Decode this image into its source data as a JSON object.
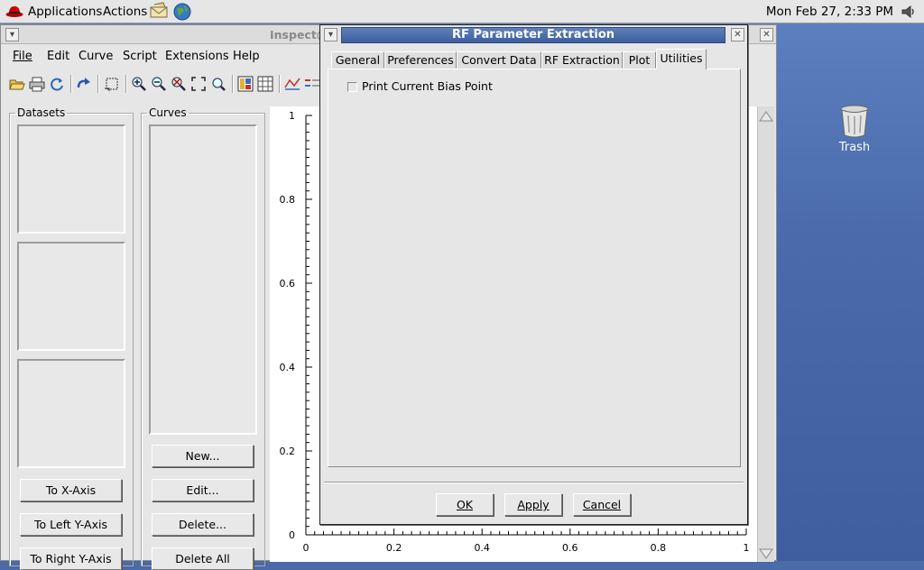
{
  "panel": {
    "applications": "Applications",
    "actions": "Actions",
    "clock": "Mon Feb 27,  2:33 PM"
  },
  "desktop": {
    "trash_label": "Trash"
  },
  "main_window": {
    "title": "Inspect@",
    "menu": [
      {
        "label": "File"
      },
      {
        "label": "Edit"
      },
      {
        "label": "Curve"
      },
      {
        "label": "Script"
      },
      {
        "label": "Extensions"
      },
      {
        "label": "Help"
      }
    ],
    "datasets_label": "Datasets",
    "curves_label": "Curves",
    "buttons": {
      "to_x_axis": "To X-Axis",
      "to_left_y_axis": "To Left Y-Axis",
      "to_right_y_axis": "To Right Y-Axis",
      "new": "New...",
      "edit": "Edit...",
      "delete": "Delete...",
      "delete_all": "Delete All"
    }
  },
  "dialog": {
    "title": "RF Parameter Extraction",
    "tabs": [
      {
        "label": "General"
      },
      {
        "label": "Preferences"
      },
      {
        "label": "Convert Data"
      },
      {
        "label": "RF Extraction"
      },
      {
        "label": "Plot"
      },
      {
        "label": "Utilities"
      }
    ],
    "active_tab": "Utilities",
    "checkbox_label": "Print Current Bias Point",
    "checkbox_checked": false,
    "ok": "OK",
    "apply": "Apply",
    "cancel": "Cancel"
  },
  "chart_data": {
    "type": "line",
    "series": [],
    "xlim": [
      0,
      1
    ],
    "ylim": [
      0,
      1
    ],
    "x_ticks": [
      "0",
      "0.2",
      "0.4",
      "0.6",
      "0.8",
      "1"
    ],
    "y_ticks": [
      "0",
      "0.2",
      "0.4",
      "0.6",
      "0.8",
      "1"
    ],
    "grid": false
  }
}
